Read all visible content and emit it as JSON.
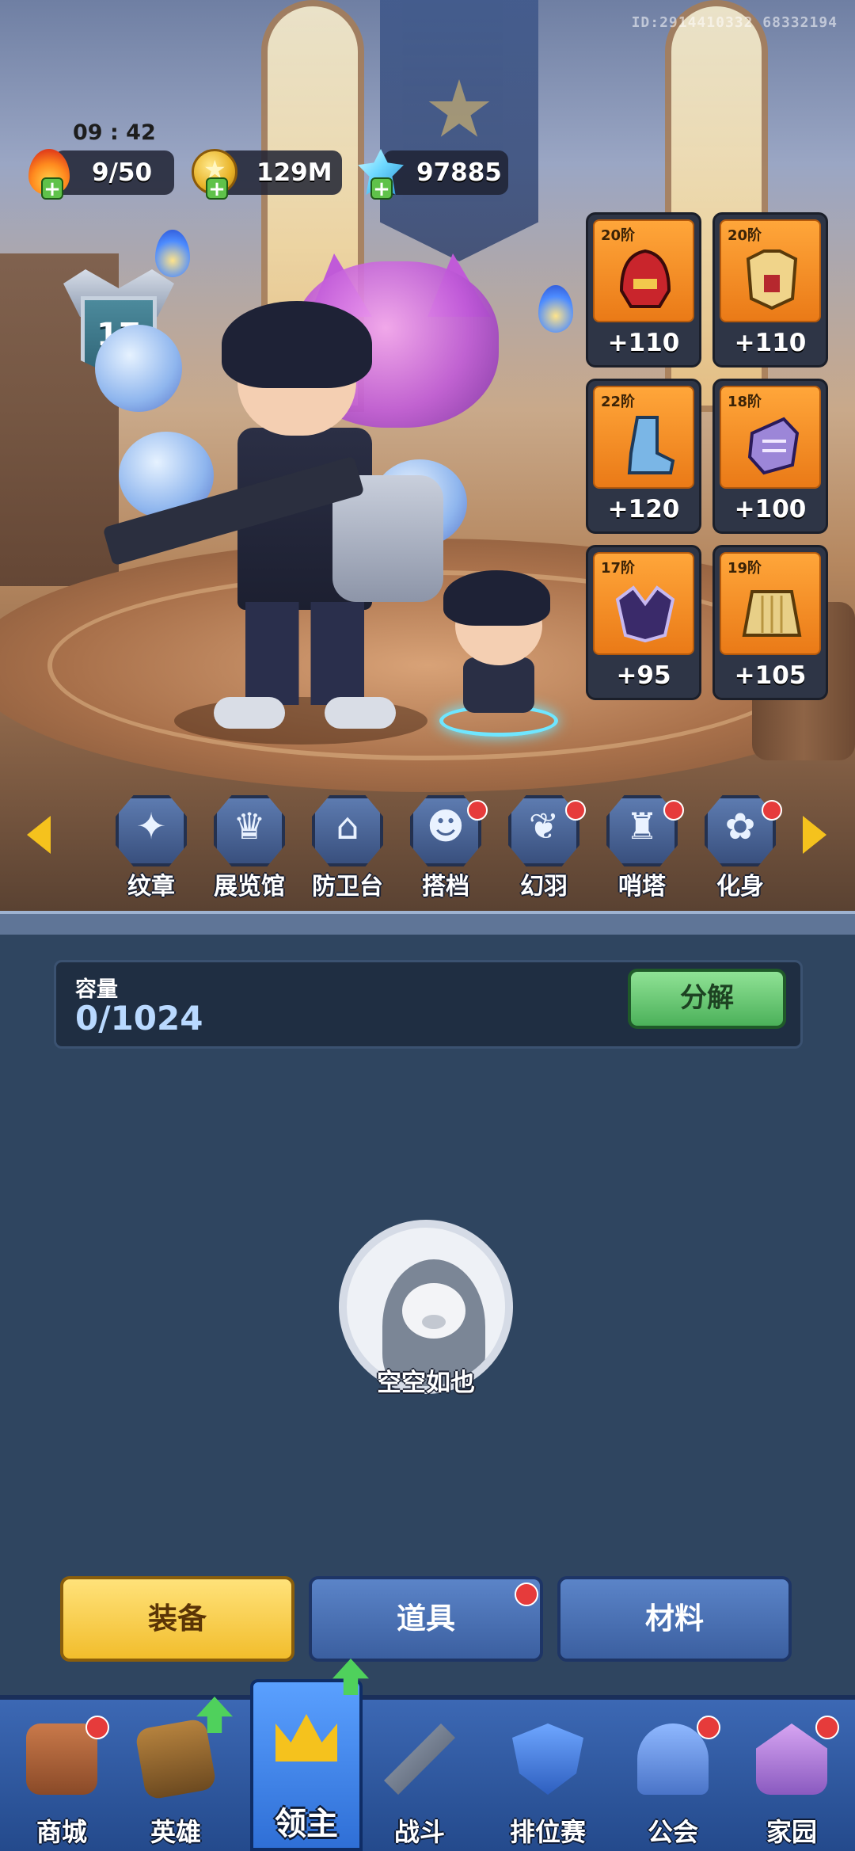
{
  "status": {
    "uid": "ID:2914410332 68332194",
    "clock": "09 : 42"
  },
  "resources": {
    "stamina": "9/50",
    "gold": "129M",
    "gems": "97885"
  },
  "lord": {
    "level": "17"
  },
  "gear": [
    {
      "tier": "20阶",
      "value": "+110",
      "icon": "helmet-icon"
    },
    {
      "tier": "20阶",
      "value": "+110",
      "icon": "armor-icon"
    },
    {
      "tier": "22阶",
      "value": "+120",
      "icon": "boots-icon"
    },
    {
      "tier": "18阶",
      "value": "+100",
      "icon": "gauntlet-icon"
    },
    {
      "tier": "17阶",
      "value": "+95",
      "icon": "shoulder-icon"
    },
    {
      "tier": "19阶",
      "value": "+105",
      "icon": "skirt-icon"
    }
  ],
  "features": [
    {
      "label": "纹章",
      "glyph": "✦",
      "dot": false
    },
    {
      "label": "展览馆",
      "glyph": "♛",
      "dot": false
    },
    {
      "label": "防卫台",
      "glyph": "⌂",
      "dot": false
    },
    {
      "label": "搭档",
      "glyph": "☻",
      "dot": true
    },
    {
      "label": "幻羽",
      "glyph": "❦",
      "dot": true
    },
    {
      "label": "哨塔",
      "glyph": "♜",
      "dot": true
    },
    {
      "label": "化身",
      "glyph": "✿",
      "dot": true
    }
  ],
  "features_partial": "装",
  "inventory": {
    "capacity_label": "容量",
    "capacity_value": "0/1024",
    "decompose_label": "分解",
    "empty_text": "空空如也",
    "tabs": {
      "equip": "装备",
      "items": "道具",
      "materials": "材料"
    }
  },
  "nav": {
    "shop": "商城",
    "heroes": "英雄",
    "lord": "领主",
    "battle": "战斗",
    "ranked": "排位赛",
    "guild": "公会",
    "home": "家园"
  },
  "colors": {
    "accent_gold": "#f5c21d",
    "panel_bg": "#2f4560",
    "nav_bg": "#3c68b4",
    "badge_red": "#e63b3b",
    "decompose_green": "#4cb15a"
  }
}
